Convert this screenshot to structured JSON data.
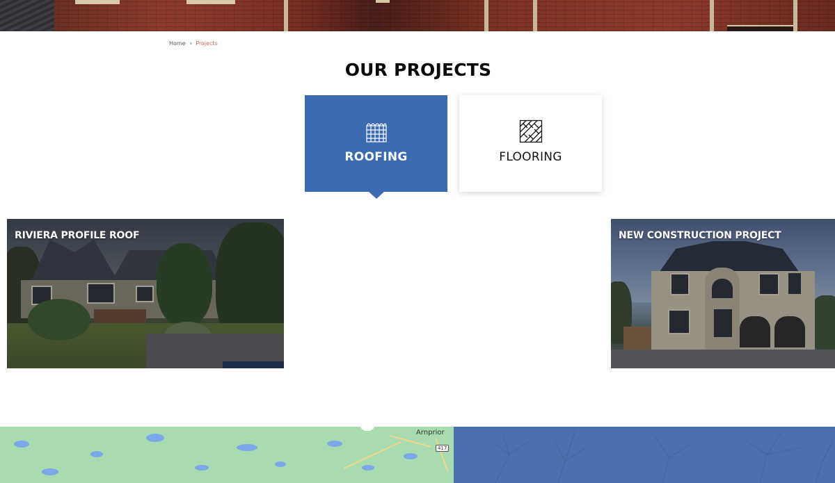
{
  "breadcrumb": {
    "home": "Home",
    "separator": "›",
    "current": "Projects"
  },
  "page": {
    "title": "OUR PROJECTS"
  },
  "tabs": [
    {
      "label": "ROOFING",
      "icon": "roof-tiles-icon",
      "active": true
    },
    {
      "label": "FLOORING",
      "icon": "parquet-floor-icon",
      "active": false
    }
  ],
  "projects": [
    {
      "title": "RIVIERA PROFILE ROOF",
      "image": "house-photo-bungalow"
    },
    {
      "title": "NEW CONSTRUCTION PROJECT",
      "image": "house-photo-stone-two-storey"
    }
  ],
  "footer": {
    "map": {
      "town": "Arnprior",
      "highway": "417"
    }
  },
  "colors": {
    "accent": "#3a6ab0",
    "breadcrumb_current": "#c46a5a",
    "footer_panel": "#4a6fae",
    "map_land": "#a8dcb0"
  }
}
